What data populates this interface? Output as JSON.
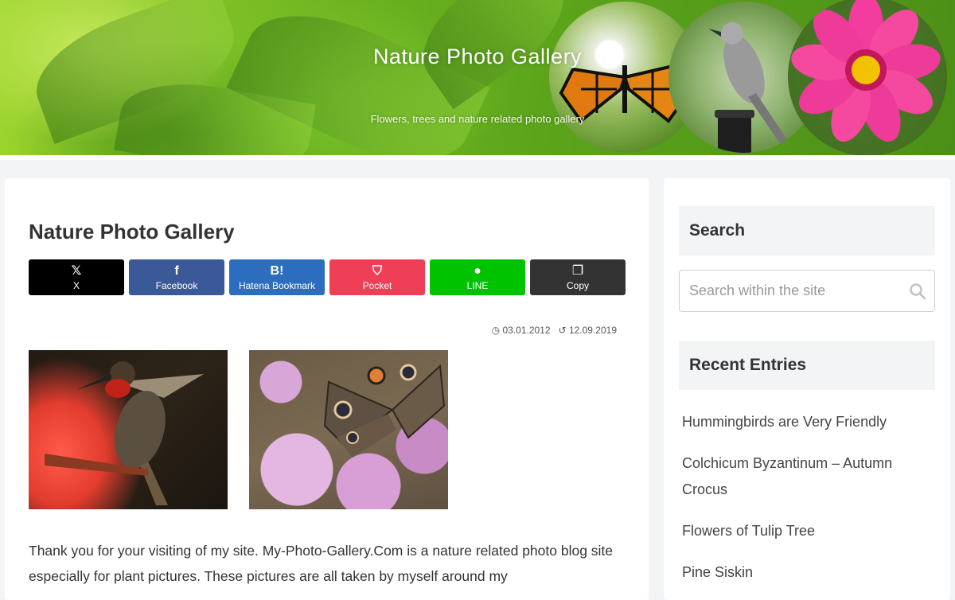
{
  "header": {
    "site_title": "Nature Photo Gallery",
    "site_description": "Flowers, trees and nature related photo gallery"
  },
  "article": {
    "title": "Nature Photo Gallery",
    "share_buttons": [
      {
        "label": "X",
        "icon": "x-logo-icon",
        "glyph": "𝕏",
        "color": "#000000"
      },
      {
        "label": "Facebook",
        "icon": "facebook-icon",
        "glyph": "f",
        "color": "#3b5998"
      },
      {
        "label": "Hatena Bookmark",
        "icon": "hatena-icon",
        "glyph": "B!",
        "color": "#2c6ebd"
      },
      {
        "label": "Pocket",
        "icon": "pocket-icon",
        "glyph": "⛉",
        "color": "#ef3f56"
      },
      {
        "label": "LINE",
        "icon": "line-icon",
        "glyph": "●",
        "color": "#00c300"
      },
      {
        "label": "Copy",
        "icon": "copy-icon",
        "glyph": "❐",
        "color": "#333333"
      }
    ],
    "published_date": "03.01.2012",
    "updated_date": "12.09.2019",
    "body": "Thank you for your visiting of my site. My-Photo-Gallery.Com is a nature related photo blog site especially for plant pictures. These pictures are all taken by myself around my"
  },
  "sidebar": {
    "search_heading": "Search",
    "search_placeholder": "Search within the site",
    "recent_heading": "Recent Entries",
    "recent_entries": [
      "Hummingbirds are Very Friendly",
      "Colchicum Byzantinum – Autumn Crocus",
      "Flowers of Tulip Tree",
      "Pine Siskin"
    ]
  }
}
